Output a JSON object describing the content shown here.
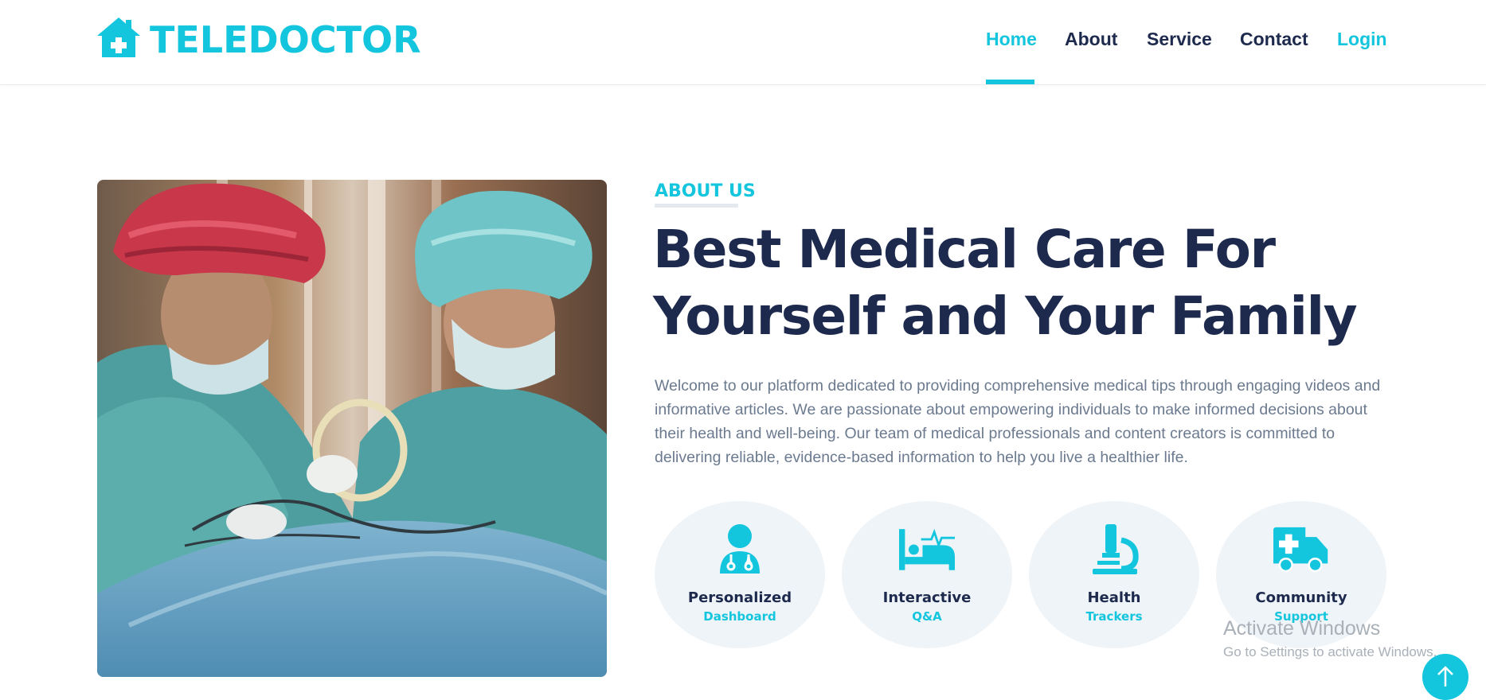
{
  "brand": {
    "name": "TELEDOCTOR",
    "logo_icon": "house-medical-icon"
  },
  "nav": {
    "items": [
      {
        "label": "Home",
        "active": true
      },
      {
        "label": "About"
      },
      {
        "label": "Service"
      },
      {
        "label": "Contact"
      }
    ],
    "login_label": "Login"
  },
  "hero_image": {
    "subject": "surgeons-operating-photo"
  },
  "about": {
    "eyebrow": "ABOUT US",
    "headline": "Best Medical Care For Yourself and Your Family",
    "body": "Welcome to our platform dedicated to providing comprehensive medical tips through engaging videos and informative articles. We are passionate about empowering individuals to make informed decisions about their health and well-being. Our team of medical professionals and content creators is committed to delivering reliable, evidence-based information to help you live a healthier life."
  },
  "features": [
    {
      "title": "Personalized",
      "subtitle": "Dashboard",
      "icon": "user-doctor-icon"
    },
    {
      "title": "Interactive",
      "subtitle": "Q&A",
      "icon": "bed-pulse-icon"
    },
    {
      "title": "Health",
      "subtitle": "Trackers",
      "icon": "microscope-icon"
    },
    {
      "title": "Community",
      "subtitle": "Support",
      "icon": "truck-medical-icon"
    }
  ],
  "watermark": {
    "line1": "Activate Windows",
    "line2": "Go to Settings to activate Windows."
  },
  "back_to_top": {
    "icon": "arrow-up-icon"
  },
  "colors": {
    "accent": "#13c5dd",
    "dark": "#1d2a4d",
    "muted": "#6b7a8f",
    "soft_bg": "#eff4f8"
  }
}
